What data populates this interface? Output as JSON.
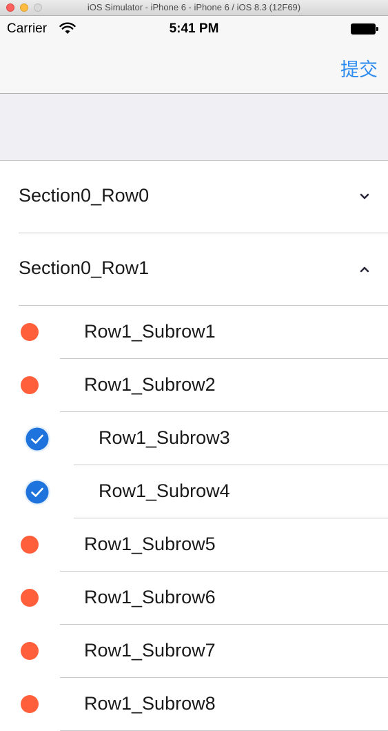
{
  "window": {
    "title": "iOS Simulator - iPhone 6 - iPhone 6 / iOS 8.3 (12F69)"
  },
  "status_bar": {
    "carrier": "Carrier",
    "time": "5:41 PM",
    "wifi_icon": "wifi-icon",
    "battery_icon": "battery-icon"
  },
  "nav_bar": {
    "submit_label": "提交"
  },
  "colors": {
    "accent": "#2d8cf0",
    "unchecked_dot": "#ff5f3a",
    "checked": "#1e74dc"
  },
  "sections": [
    {
      "label": "Section0_Row0",
      "expanded": false,
      "chevron_icon": "chevron-down-icon"
    },
    {
      "label": "Section0_Row1",
      "expanded": true,
      "chevron_icon": "chevron-up-icon"
    }
  ],
  "subrows": [
    {
      "label": "Row1_Subrow1",
      "checked": false
    },
    {
      "label": "Row1_Subrow2",
      "checked": false
    },
    {
      "label": "Row1_Subrow3",
      "checked": true
    },
    {
      "label": "Row1_Subrow4",
      "checked": true
    },
    {
      "label": "Row1_Subrow5",
      "checked": false
    },
    {
      "label": "Row1_Subrow6",
      "checked": false
    },
    {
      "label": "Row1_Subrow7",
      "checked": false
    },
    {
      "label": "Row1_Subrow8",
      "checked": false
    }
  ]
}
